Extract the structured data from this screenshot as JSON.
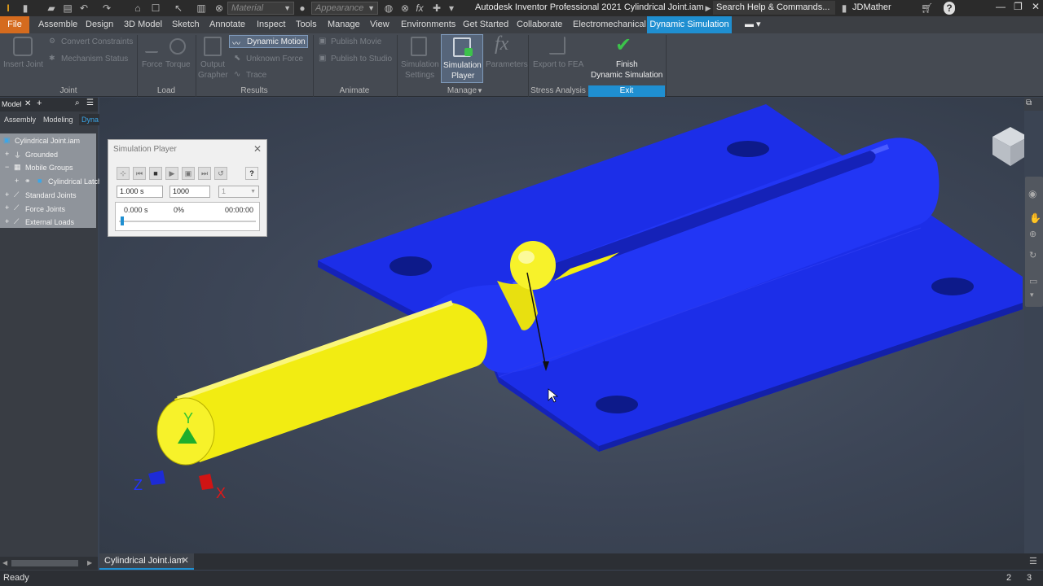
{
  "window": {
    "title": "Autodesk Inventor Professional 2021    Cylindrical Joint.iam",
    "search_placeholder": "Search Help & Commands...",
    "user": "JDMather"
  },
  "quick_access": {
    "material_placeholder": "Material",
    "appearance_placeholder": "Appearance",
    "fx_label": "fx"
  },
  "tabs": [
    "File",
    "Assemble",
    "Design",
    "3D Model",
    "Sketch",
    "Annotate",
    "Inspect",
    "Tools",
    "Manage",
    "View",
    "Environments",
    "Get Started",
    "Collaborate",
    "Electromechanical",
    "Dynamic Simulation"
  ],
  "ribbon": {
    "joint": {
      "insert_joint": "Insert Joint",
      "convert_constraints": "Convert Constraints",
      "mechanism_status": "Mechanism Status",
      "title": "Joint"
    },
    "load": {
      "force": "Force",
      "torque": "Torque",
      "title": "Load"
    },
    "results": {
      "output_grapher_1": "Output",
      "output_grapher_2": "Grapher",
      "dynamic_motion": "Dynamic Motion",
      "unknown_force": "Unknown Force",
      "trace": "Trace",
      "title": "Results"
    },
    "animate": {
      "publish_movie": "Publish Movie",
      "publish_studio": "Publish to Studio",
      "title": "Animate"
    },
    "manage": {
      "sim_settings_1": "Simulation",
      "sim_settings_2": "Settings",
      "sim_player_1": "Simulation",
      "sim_player_2": "Player",
      "parameters": "Parameters",
      "title": "Manage"
    },
    "stress": {
      "export_fea": "Export to FEA",
      "title": "Stress Analysis"
    },
    "exit": {
      "finish_1": "Finish",
      "finish_2": "Dynamic Simulation",
      "title": "Exit"
    }
  },
  "browser": {
    "title": "Model",
    "tabs": [
      "Assembly",
      "Modeling",
      "Dyna"
    ],
    "nodes": [
      "Cylindrical Joint.iam",
      "Grounded",
      "Mobile Groups",
      "Cylindrical Latch",
      "Standard Joints",
      "Force Joints",
      "External Loads"
    ]
  },
  "sim_player": {
    "title": "Simulation Player",
    "final_time": "1.000 s",
    "images": "1000",
    "filter": "1",
    "current_time": "0.000 s",
    "percent": "0%",
    "elapsed": "00:00:00",
    "progress": 0.0
  },
  "triad": {
    "x": "X",
    "y": "Y",
    "z": "Z"
  },
  "doc_tab": "Cylindrical Joint.iam",
  "status": {
    "text": "Ready",
    "count1": "2",
    "count2": "3"
  },
  "colors": {
    "accent": "#1f8fd1",
    "file_tab": "#d56b1e",
    "part_blue": "#1f2ff0",
    "part_yellow": "#f2ec12",
    "finish_check": "#3cc24b"
  }
}
